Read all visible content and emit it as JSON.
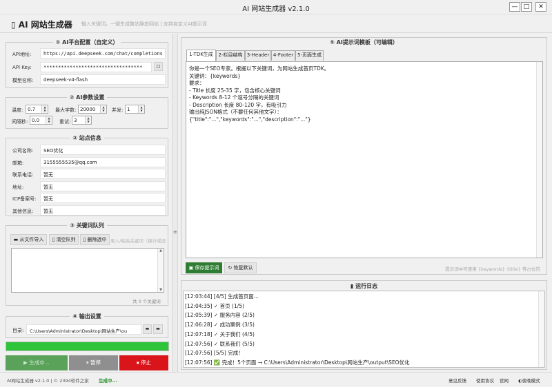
{
  "window": {
    "title": "AI 网站生成器 v2.1.0",
    "min": "—",
    "max": "□",
    "close": "✕"
  },
  "header": {
    "app_title": "AI 网站生成器",
    "subtitle": "输入关键词，一键生成整站静态网站 | 支持自定义AI提示词"
  },
  "sections": {
    "ai_platform": "① AI平台配置（自定义）",
    "ai_params": "② AI参数设置",
    "site_info": "② 站点信息",
    "keywords": "③ 关键词队列",
    "output": "④ 输出设置",
    "prompt": "⑤ AI提示词模板（可编辑）",
    "log": "运行日志"
  },
  "platform": {
    "api_url_label": "API地址:",
    "api_url": "https://api.deepseek.com/chat/completions",
    "api_key_label": "API Key:",
    "api_key": "**********************************",
    "model_label": "模型名称:",
    "model": "deepseek-v4-flash"
  },
  "params": {
    "temp_label": "温度:",
    "temp": "0.7",
    "max_label": "最大字数:",
    "max": "20000",
    "concurrency_label": "并发:",
    "concurrency": "1",
    "interval_label": "间隔秒:",
    "interval": "0.0",
    "retry_label": "重试:",
    "retry": "3"
  },
  "site": {
    "rows": [
      {
        "label": "公司名称:",
        "value": "SEO优化"
      },
      {
        "label": "邮箱:",
        "value": "3155555535@qq.com"
      },
      {
        "label": "联系电话:",
        "value": "暂无"
      },
      {
        "label": "地址:",
        "value": "暂无"
      },
      {
        "label": "ICP备案号:",
        "value": "暂无"
      },
      {
        "label": "其他信息:",
        "value": "暂无"
      }
    ]
  },
  "keywords": {
    "import": "从文件导入",
    "clear": "清空队列",
    "delete": "删除选中",
    "hint": "录入/粘贴关键词（换行或逗",
    "count": "共 0 个关键词"
  },
  "output": {
    "dir_label": "目录:",
    "dir": "C:\\Users\\Administrator\\Desktop\\网站生产\\ou"
  },
  "progress": {
    "value": 1.0
  },
  "actions": {
    "start": "▶ 生成中...",
    "pause": "⏸ 暂停",
    "stop": "⏹ 停止"
  },
  "statusbar": {
    "left": "AI网站生成器 v2.1.0 | © 2394软件之家",
    "status": "生成中...",
    "feedback": "意见反馈",
    "agreement": "使用协议",
    "website": "官网",
    "night": "夜晚模式"
  },
  "tabs": [
    "1-TDK生成",
    "2-栏目结构",
    "3-Header",
    "4-Footer",
    "5-页面生成"
  ],
  "prompt": {
    "lines": [
      "你是一个SEO专家。根据以下关键词，为网站生成首页TDK。",
      "关键词：{keywords}",
      "要求：",
      "- Title 长度 25-35 字，包含核心关键词",
      "- Keywords 8-12 个逗号分隔的关键词",
      "- Description 长度 80-120 字，有吸引力",
      "输出纯JSON格式（不要任何其他文字）：",
      "{\"title\":\"...\",\"keywords\":\"...\",\"description\":\"...\"}"
    ],
    "save": "保存提示词",
    "restore": "恢复默认",
    "hint": "提示词中可使用 {keywords} {title} 等占位符"
  },
  "log": {
    "lines": [
      "[12:03:44] [4/5] 生成首页面...",
      "[12:04:35]  ✓ 首页 (1/5)",
      "[12:05:39]  ✓ 服务内容 (2/5)",
      "[12:06:28]  ✓ 成功案例 (3/5)",
      "[12:07:18]  ✓ 关于我们 (4/5)",
      "[12:07:56]  ✓ 联系我们 (5/5)",
      "[12:07:56] [5/5] 完成！",
      "[12:07:56] ✅ 完成！5个页面 → C:\\Users\\Administrator\\Desktop\\网站生产\\output\\SEO优化"
    ]
  },
  "colors": {
    "green": "#2ec43a",
    "start_bg": "#5aa15a",
    "pause_bg": "#8f8f8f",
    "stop_bg": "#d9141b",
    "save_bg": "#2e7d32"
  }
}
